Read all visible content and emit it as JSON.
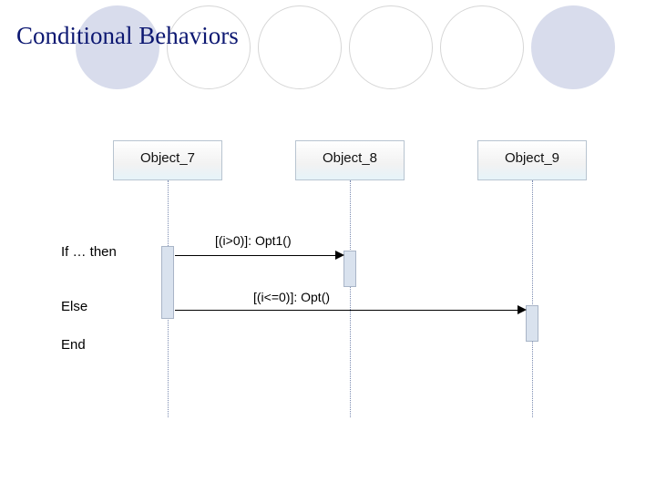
{
  "title": "Conditional Behaviors",
  "objects": {
    "obj7": "Object_7",
    "obj8": "Object_8",
    "obj9": "Object_9"
  },
  "messages": {
    "m1": "[(i>0)]: Opt1()",
    "m2": "[(i<=0)]: Opt()"
  },
  "labels": {
    "if_then": "If … then",
    "else": "Else",
    "end": "End"
  },
  "chart_data": {
    "type": "sequence-diagram",
    "participants": [
      "Object_7",
      "Object_8",
      "Object_9"
    ],
    "interactions": [
      {
        "from": "Object_7",
        "to": "Object_8",
        "guard": "(i>0)",
        "message": "Opt1()",
        "branch": "if"
      },
      {
        "from": "Object_7",
        "to": "Object_9",
        "guard": "(i<=0)",
        "message": "Opt()",
        "branch": "else"
      }
    ],
    "annotations": [
      "If … then",
      "Else",
      "End"
    ]
  }
}
